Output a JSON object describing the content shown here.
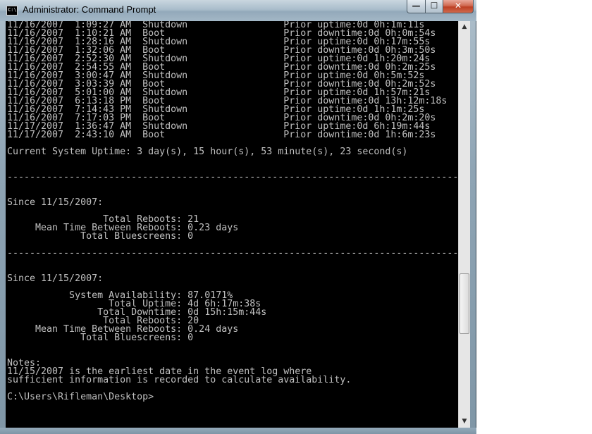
{
  "window": {
    "title": "Administrator: Command Prompt",
    "icon_text": "C:\\"
  },
  "controls": {
    "minimize": "—",
    "maximize": "☐",
    "close": "✕"
  },
  "scrollbar": {
    "up": "▲",
    "down": "▼"
  },
  "console": {
    "lines": [
      "11/16/2007  1:09:27 AM  Shutdown                 Prior uptime:0d 0h:1m:11s",
      "11/16/2007  1:10:21 AM  Boot                     Prior downtime:0d 0h:0m:54s",
      "11/16/2007  1:28:16 AM  Shutdown                 Prior uptime:0d 0h:17m:55s",
      "11/16/2007  1:32:06 AM  Boot                     Prior downtime:0d 0h:3m:50s",
      "11/16/2007  2:52:30 AM  Shutdown                 Prior uptime:0d 1h:20m:24s",
      "11/16/2007  2:54:55 AM  Boot                     Prior downtime:0d 0h:2m:25s",
      "11/16/2007  3:00:47 AM  Shutdown                 Prior uptime:0d 0h:5m:52s",
      "11/16/2007  3:03:39 AM  Boot                     Prior downtime:0d 0h:2m:52s",
      "11/16/2007  5:01:00 AM  Shutdown                 Prior uptime:0d 1h:57m:21s",
      "11/16/2007  6:13:18 PM  Boot                     Prior downtime:0d 13h:12m:18s",
      "11/16/2007  7:14:43 PM  Shutdown                 Prior uptime:0d 1h:1m:25s",
      "11/16/2007  7:17:03 PM  Boot                     Prior downtime:0d 0h:2m:20s",
      "11/17/2007  1:36:47 AM  Shutdown                 Prior uptime:0d 6h:19m:44s",
      "11/17/2007  2:43:10 AM  Boot                     Prior downtime:0d 1h:6m:23s",
      "",
      "Current System Uptime: 3 day(s), 15 hour(s), 53 minute(s), 23 second(s)",
      "",
      "",
      "--------------------------------------------------------------------------------",
      "",
      "",
      "Since 11/15/2007:",
      "",
      "                 Total Reboots: 21",
      "     Mean Time Between Reboots: 0.23 days",
      "             Total Bluescreens: 0",
      "",
      "--------------------------------------------------------------------------------",
      "",
      "",
      "Since 11/15/2007:",
      "",
      "           System Availability: 87.0171%",
      "                  Total Uptime: 4d 6h:17m:38s",
      "                Total Downtime: 0d 15h:15m:44s",
      "                 Total Reboots: 20",
      "     Mean Time Between Reboots: 0.24 days",
      "             Total Bluescreens: 0",
      "",
      "",
      "Notes:",
      "11/15/2007 is the earliest date in the event log where",
      "sufficient information is recorded to calculate availability.",
      "",
      "C:\\Users\\Rifleman\\Desktop>"
    ]
  }
}
